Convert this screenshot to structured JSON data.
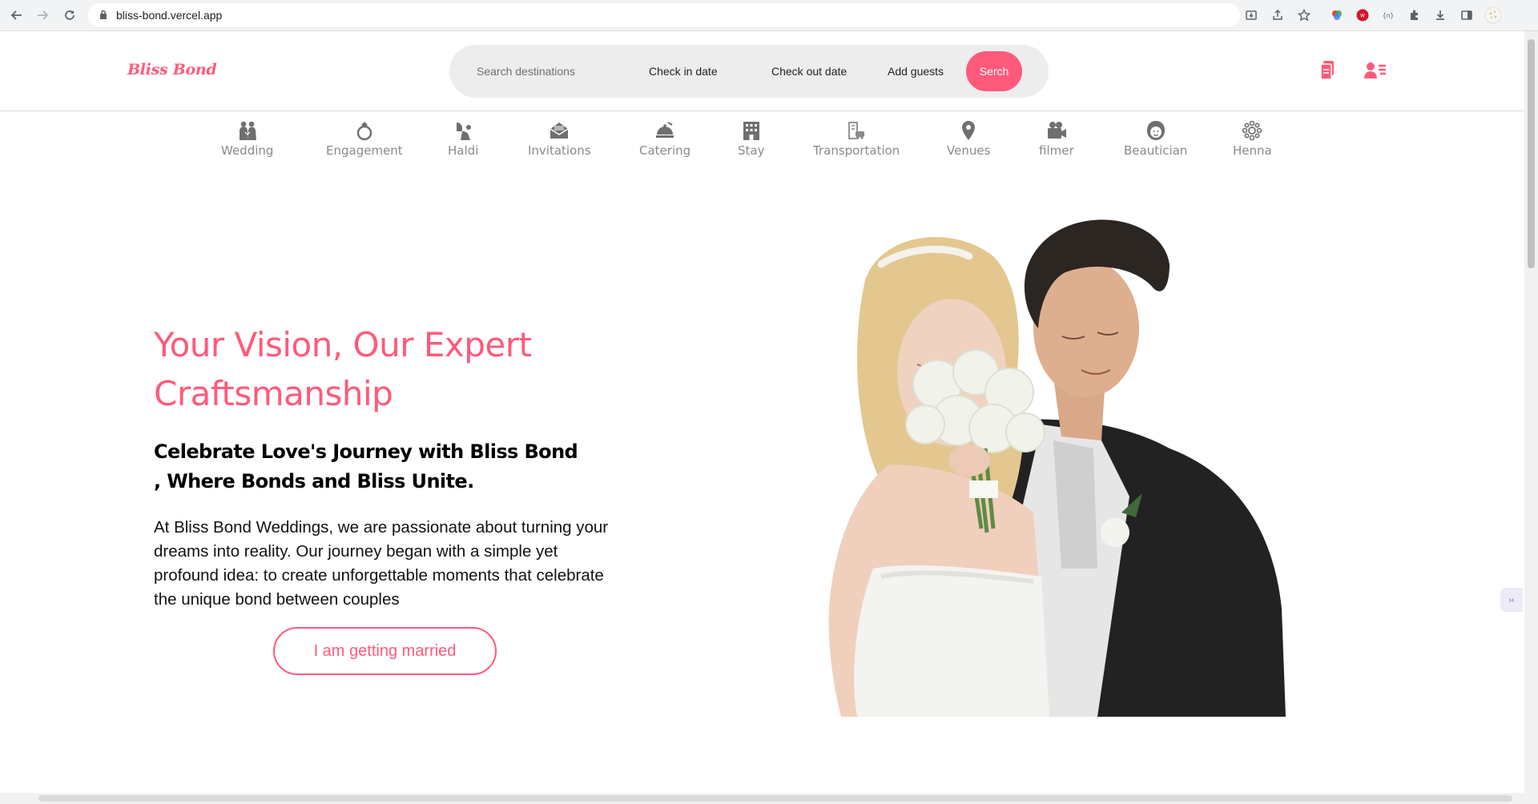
{
  "browser": {
    "url": "bliss-bond.vercel.app"
  },
  "header": {
    "logo": "Bliss Bond",
    "search": {
      "placeholder": "Search destinations",
      "check_in": "Check in date",
      "check_out": "Check out date",
      "guests": "Add guests",
      "button": "Serch"
    }
  },
  "categories": [
    {
      "label": "Wedding",
      "icon": "couple-icon"
    },
    {
      "label": "Engagement",
      "icon": "ring-icon"
    },
    {
      "label": "Haldi",
      "icon": "haldi-icon"
    },
    {
      "label": "Invitations",
      "icon": "envelope-icon"
    },
    {
      "label": "Catering",
      "icon": "cloche-icon"
    },
    {
      "label": "Stay",
      "icon": "hotel-icon"
    },
    {
      "label": "Transportation",
      "icon": "transport-icon"
    },
    {
      "label": "Venues",
      "icon": "location-pin-icon"
    },
    {
      "label": "filmer",
      "icon": "video-camera-icon"
    },
    {
      "label": "Beautician",
      "icon": "face-icon"
    },
    {
      "label": "Henna",
      "icon": "henna-icon"
    }
  ],
  "hero": {
    "title_line1": "Your Vision, Our Expert",
    "title_line2": "Craftsmanship",
    "subtitle_line1": "Celebrate Love's Journey with Bliss Bond",
    "subtitle_line2": ", Where Bonds and Bliss Unite.",
    "body": "At Bliss Bond Weddings, we are passionate about turning your dreams into reality. Our journey began with a simple yet profound idea: to create unforgettable moments that celebrate the unique bond between couples",
    "cta": "I am getting married"
  },
  "colors": {
    "accent": "#ff5a7a",
    "category_gray": "#8a8a8a",
    "search_bg": "#ededed"
  }
}
